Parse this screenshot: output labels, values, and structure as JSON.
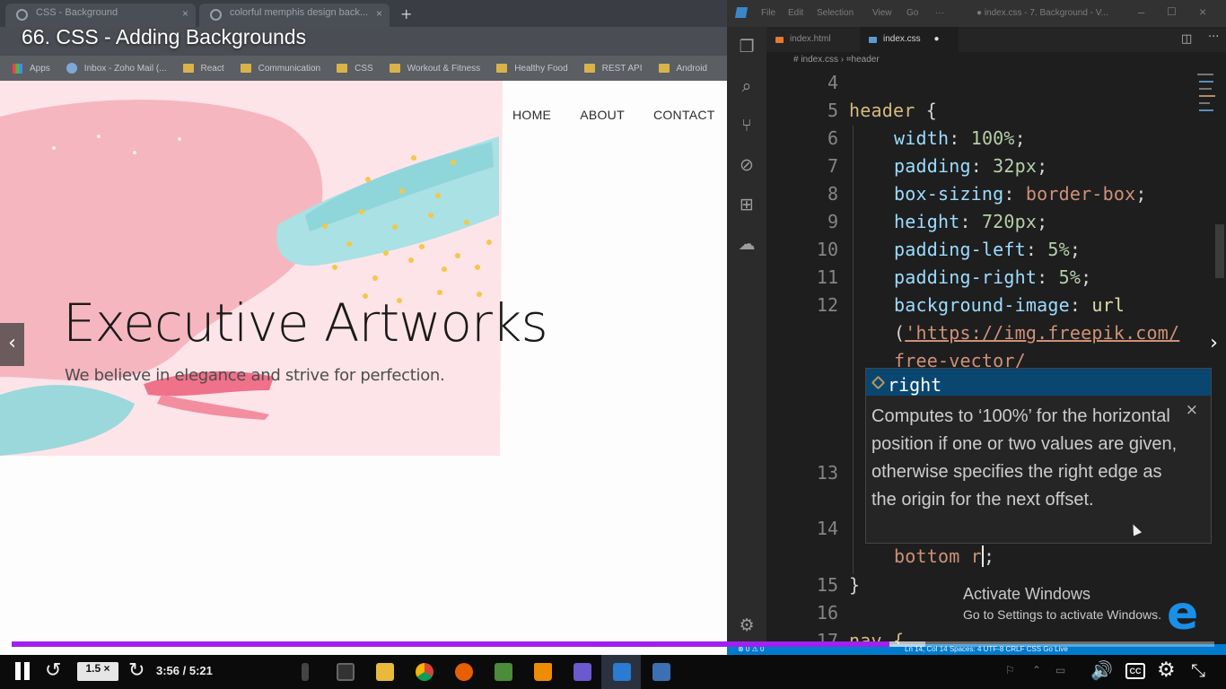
{
  "video": {
    "title": "66. CSS - Adding Backgrounds",
    "speed": "1.5 ×",
    "time": "3:56 / 5:21",
    "progress_fraction": 0.73
  },
  "browser": {
    "tabs": [
      {
        "label": "CSS - Background"
      },
      {
        "label": "colorful memphis design back..."
      }
    ],
    "bookmarks": [
      "Apps",
      "Inbox - Zoho Mail (...",
      "React",
      "Communication",
      "CSS",
      "Workout & Fitness",
      "Healthy Food",
      "REST API",
      "Android"
    ]
  },
  "site": {
    "nav": [
      "HOME",
      "ABOUT",
      "CONTACT"
    ],
    "hero_title": "Executive Artworks",
    "hero_sub": "We believe in elegance and strive for perfection."
  },
  "vscode": {
    "menu": [
      "File",
      "Edit",
      "Selection",
      "View",
      "Go",
      "···"
    ],
    "window_title": "● index.css - 7. Background - V...",
    "tabs": [
      {
        "label": "index.html",
        "active": false
      },
      {
        "label": "index.css",
        "active": true,
        "modified": "●"
      }
    ],
    "breadcrumb": "# index.css › ⌗header",
    "line_numbers": [
      "4",
      "5",
      "6",
      "7",
      "8",
      "9",
      "10",
      "11",
      "12",
      "13",
      "14",
      "15",
      "16",
      "17"
    ],
    "code": {
      "l5_sel": "header",
      "l5_brace": " {",
      "l6_prop": "width",
      "l6_val": "100%",
      "l7_prop": "padding",
      "l7_val": "32px",
      "l8_prop": "box-sizing",
      "l8_val": "border-box",
      "l9_prop": "height",
      "l9_val": "720px",
      "l10_prop": "padding-left",
      "l10_val": "5%",
      "l11_prop": "padding-right",
      "l11_val": "5%",
      "l12_prop": "background-image",
      "l12_fn": "url",
      "l12_open": "(",
      "l12_str1": "'https://img.freepik.com/",
      "l12_str2": "free-vector/",
      "l14_val": "bottom r",
      "l14_end": ";",
      "l15": "}",
      "l17": "nav {"
    },
    "suggest": {
      "item": "right",
      "doc": "Computes to ‘100%’ for the horizontal position if one or two values are given, otherwise specifies the right edge as the origin for the next offset.",
      "close": "×"
    },
    "status": {
      "left": "⊗ 0  ⚠ 0",
      "right": "Ln 14, Col 14   Spaces: 4   UTF-8   CRLF   CSS   Go Live"
    }
  },
  "watermark": {
    "title": "Activate Windows",
    "sub": "Go to Settings to activate Windows."
  },
  "icons": {
    "prev": "‹",
    "next": "›",
    "replay": "↺",
    "forward": "↻",
    "volume": "🔊",
    "cc": "CC",
    "settings": "⚙",
    "exit_fullscreen": "⤡",
    "new_tab": "+"
  },
  "colors": {
    "accent_progress": "#a020f0",
    "vscode_status": "#007acc",
    "selector": "#d7ba7d",
    "property": "#9cdcfe",
    "value": "#ce9178"
  }
}
